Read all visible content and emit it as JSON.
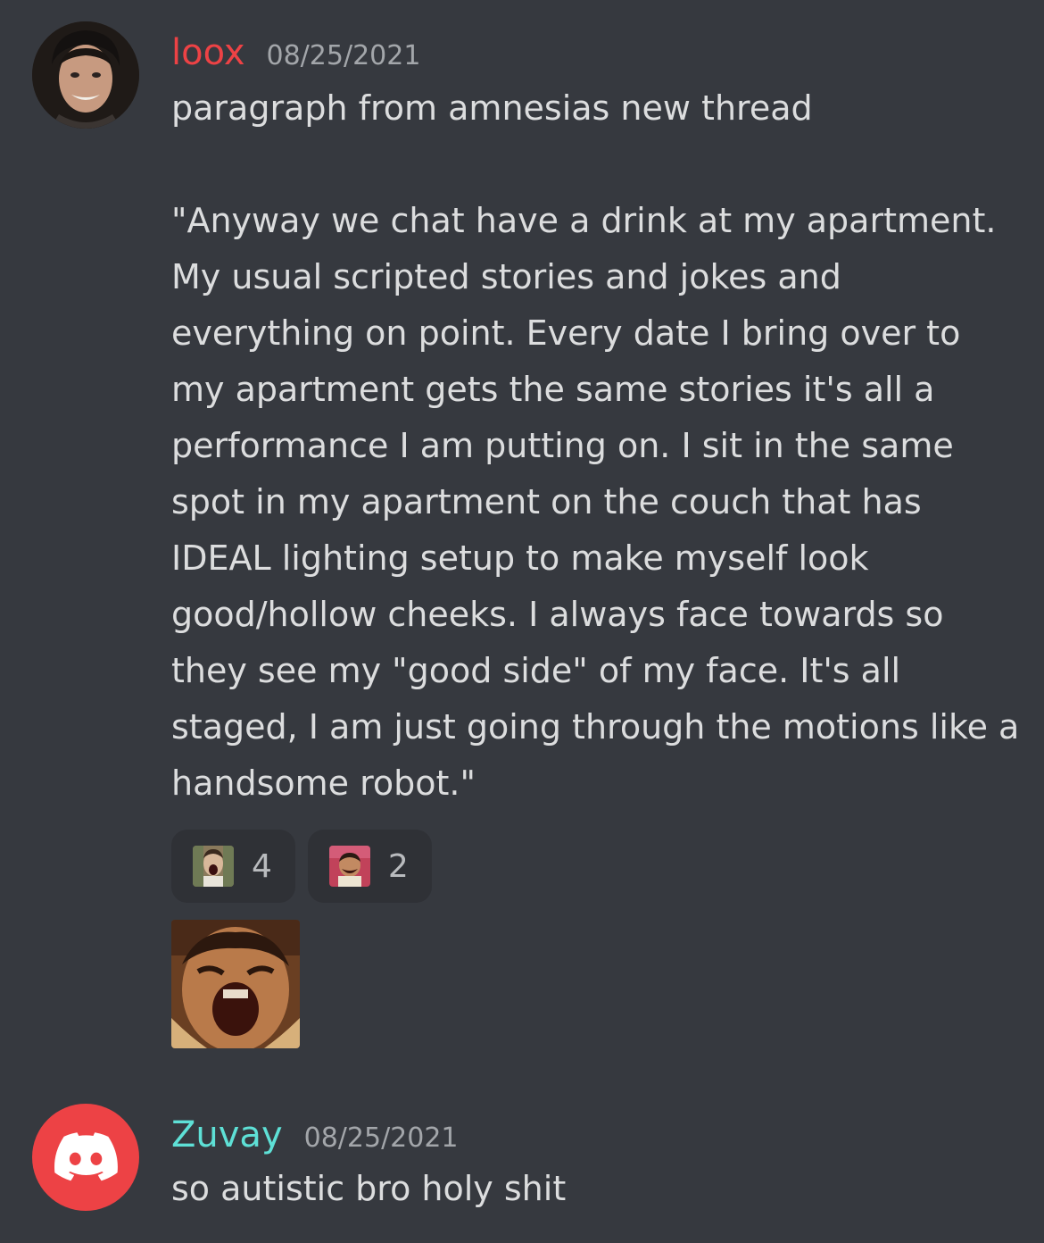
{
  "messages": [
    {
      "username": "loox",
      "username_color": "#ed4245",
      "timestamp": "08/25/2021",
      "avatar": "user-photo-avatar",
      "text": "paragraph from amnesias new thread\n\n\"Anyway we chat have a drink at my apartment. My usual scripted stories and jokes and everything on point. Every date I bring over to my apartment gets the same stories it's all a performance I am putting on. I sit in the same spot in my apartment on the couch that has IDEAL lighting setup to make myself look good/hollow cheeks. I always face towards so they see my \"good side\" of my face. It's all staged, I am just going through the motions like a handsome robot.\"",
      "reactions": [
        {
          "emoji": "screaming-man-emoji",
          "count": "4"
        },
        {
          "emoji": "laughing-man-emoji",
          "count": "2"
        }
      ],
      "sticker": "laughing-man-gif"
    },
    {
      "username": "Zuvay",
      "username_color": "#5ee0d6",
      "timestamp": "08/25/2021",
      "avatar": "discord-default-avatar",
      "text": "so autistic bro holy shit"
    }
  ]
}
